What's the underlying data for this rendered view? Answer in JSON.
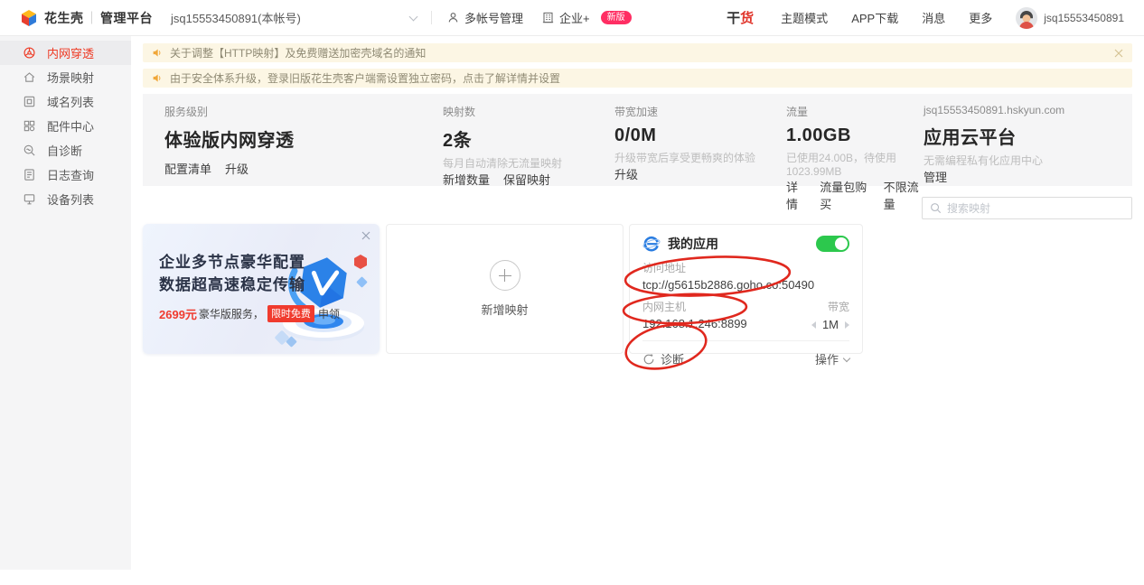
{
  "header": {
    "logo_brand": "花生壳",
    "logo_divider": "｜",
    "logo_product": "管理平台",
    "account_selector": "jsq15553450891(本帐号)",
    "multi_account": "多帐号管理",
    "enterprise": "企业+",
    "new_badge": "新版",
    "ganhuo_char1": "干",
    "ganhuo_char2": "货",
    "theme_mode": "主题模式",
    "app_download": "APP下载",
    "messages": "消息",
    "more": "更多",
    "username": "jsq15553450891"
  },
  "sidebar": {
    "items": [
      {
        "label": "内网穿透",
        "icon": "nat-traversal",
        "active": true
      },
      {
        "label": "场景映射",
        "icon": "scene-mapping",
        "active": false
      },
      {
        "label": "域名列表",
        "icon": "domain-list",
        "active": false
      },
      {
        "label": "配件中心",
        "icon": "accessory-center",
        "active": false
      },
      {
        "label": "自诊断",
        "icon": "self-diagnosis",
        "active": false
      },
      {
        "label": "日志查询",
        "icon": "log-query",
        "active": false
      },
      {
        "label": "设备列表",
        "icon": "device-list",
        "active": false
      }
    ]
  },
  "banners": [
    {
      "text": "关于调整【HTTP映射】及免费赠送加密壳域名的通知",
      "closable": true
    },
    {
      "text": "由于安全体系升级，登录旧版花生壳客户端需设置独立密码，点击了解详情并设置",
      "closable": false
    }
  ],
  "stats": {
    "columns": [
      {
        "label": "服务级别",
        "value": "体验版内网穿透",
        "sub": "",
        "links": [
          "配置清单",
          "升级"
        ]
      },
      {
        "label": "映射数",
        "value": "2条",
        "sub": "每月自动清除无流量映射",
        "links": [
          "新增数量",
          "保留映射"
        ]
      },
      {
        "label": "带宽加速",
        "value": "0/0M",
        "sub": "升级带宽后享受更畅爽的体验",
        "links": [
          "升级"
        ]
      },
      {
        "label": "流量",
        "value": "1.00GB",
        "sub": "已使用24.00B，待使用1023.99MB",
        "links": [
          "详情",
          "流量包购买",
          "不限流量"
        ]
      },
      {
        "label": "jsq15553450891.hskyun.com",
        "value": "应用云平台",
        "sub": "无需编程私有化应用中心",
        "links": [
          "管理"
        ]
      }
    ]
  },
  "search": {
    "placeholder": "搜索映射"
  },
  "promo_card": {
    "title_line1": "企业多节点豪华配置",
    "title_line2": "数据超高速稳定传输",
    "price": "2699元",
    "price_suffix": "豪华版服务，",
    "badge": "限时免费",
    "badge_suffix": "申领"
  },
  "add_card": {
    "label": "新增映射"
  },
  "app_card": {
    "title": "我的应用",
    "toggle_state": "on",
    "access_label": "访问地址",
    "access_value": "tcp://g5615b2886.goho.co:50490",
    "host_label": "内网主机",
    "host_value": "192.168.1.246:8899",
    "bandwidth_label": "带宽",
    "bandwidth_value": "1M",
    "diagnose_label": "诊断",
    "actions_label": "操作"
  },
  "colors": {
    "brand_red": "#ee3a24",
    "badge_pink": "#ff2e63",
    "toggle_green": "#2cc84d",
    "banner_bg": "#fcf6e4",
    "annotation_red": "#e0281e"
  }
}
